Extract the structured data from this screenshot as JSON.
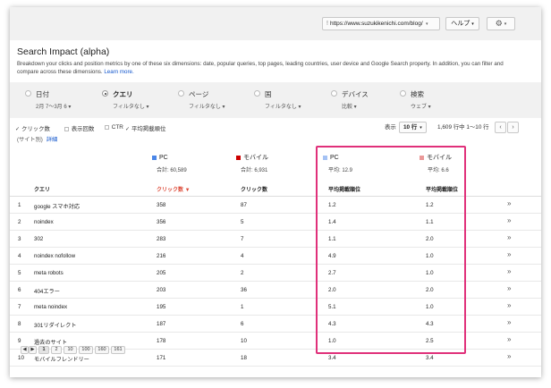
{
  "topbar": {
    "url": "https://www.suzukikenichi.com/blog/",
    "help_label": "ヘルプ",
    "gear_icon": "gear-icon"
  },
  "page": {
    "title": "Search Impact (alpha)",
    "description_1": "Breakdown your clicks and position metrics by one of these six dimensions: date, popular queries, top pages, leading countries, user device and Google Search property. In addition, you can filter and",
    "description_2": "compare across these dimensions.",
    "learn_more": "Learn more."
  },
  "dimensions": [
    {
      "name": "日付",
      "sub": "2月 7〜3月 6 ▾",
      "selected": false
    },
    {
      "name": "クエリ",
      "sub": "フィルタなし ▾",
      "selected": true
    },
    {
      "name": "ページ",
      "sub": "フィルタなし ▾",
      "selected": false
    },
    {
      "name": "国",
      "sub": "フィルタなし ▾",
      "selected": false
    },
    {
      "name": "デバイス",
      "sub": "比較 ▾",
      "selected": false
    },
    {
      "name": "検索",
      "sub": "ウェブ ▾",
      "selected": false
    }
  ],
  "metrics": [
    {
      "label": "クリック数",
      "checked": true
    },
    {
      "label": "表示回数",
      "checked": false
    },
    {
      "label": "CTR",
      "checked": false
    },
    {
      "label": "平均掲載順位",
      "checked": true
    }
  ],
  "subline": {
    "label": "(サイト別)",
    "detail": "詳細"
  },
  "pager": {
    "show_label": "表示",
    "rows_value": "10 行",
    "range": "1,609 行中 1〜10 行",
    "prev_icon": "chevron-left-icon",
    "next_icon": "chevron-right-icon"
  },
  "columns": {
    "group_pc_clicks": {
      "label": "PC",
      "sub": "合計: 60,589",
      "color": "#4a86e8"
    },
    "group_mobile_clicks": {
      "label": "モバイル",
      "sub": "合計: 6,931",
      "color": "#cc0000"
    },
    "group_pc_pos": {
      "label": "PC",
      "sub": "平均: 12.9",
      "color": "#a4c2f4"
    },
    "group_mobile_pos": {
      "label": "モバイル",
      "sub": "平均: 6.6",
      "color": "#ea9999"
    },
    "h_query": "クエリ",
    "h_pc_clicks": "クリック数 ▼",
    "h_mobile_clicks": "クリック数",
    "h_pc_pos": "平均掲載順位",
    "h_mobile_pos": "平均掲載順位"
  },
  "rows": [
    {
      "n": "1",
      "q": "google スマホ対応",
      "pc": "358",
      "mo": "87",
      "ppc": "1.2",
      "pmo": "1.2"
    },
    {
      "n": "2",
      "q": "noindex",
      "pc": "356",
      "mo": "5",
      "ppc": "1.4",
      "pmo": "1.1"
    },
    {
      "n": "3",
      "q": "302",
      "pc": "283",
      "mo": "7",
      "ppc": "1.1",
      "pmo": "2.0"
    },
    {
      "n": "4",
      "q": "noindex nofollow",
      "pc": "216",
      "mo": "4",
      "ppc": "4.9",
      "pmo": "1.0"
    },
    {
      "n": "5",
      "q": "meta robots",
      "pc": "205",
      "mo": "2",
      "ppc": "2.7",
      "pmo": "1.0"
    },
    {
      "n": "6",
      "q": "404エラー",
      "pc": "203",
      "mo": "36",
      "ppc": "2.0",
      "pmo": "2.0"
    },
    {
      "n": "7",
      "q": "meta noindex",
      "pc": "195",
      "mo": "1",
      "ppc": "5.1",
      "pmo": "1.0"
    },
    {
      "n": "8",
      "q": "301リダイレクト",
      "pc": "187",
      "mo": "6",
      "ppc": "4.3",
      "pmo": "4.3"
    },
    {
      "n": "9",
      "q": "過去のサイト",
      "pc": "178",
      "mo": "10",
      "ppc": "1.0",
      "pmo": "2.5"
    },
    {
      "n": "10",
      "q": "モバイルフレンドリー",
      "pc": "171",
      "mo": "18",
      "ppc": "3.4",
      "pmo": "3.4"
    }
  ],
  "expand_icon": "»",
  "bottom_pager": [
    "◀",
    "▶",
    "1",
    "2",
    "10",
    "100",
    "160",
    "161"
  ]
}
